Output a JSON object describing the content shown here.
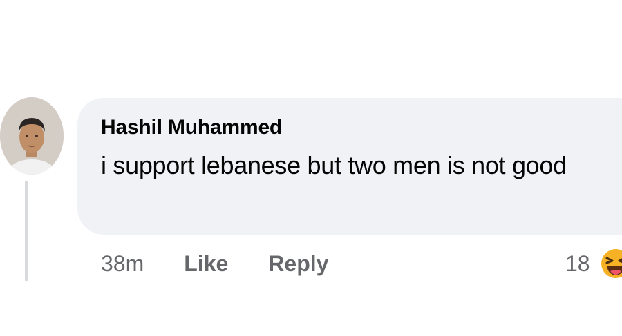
{
  "comment": {
    "author": "Hashil Muhammed",
    "text": "i support lebanese but two men is not good",
    "time": "38m",
    "like_label": "Like",
    "reply_label": "Reply",
    "reaction_count": "18",
    "reaction_icon": "haha-emoji-icon",
    "colors": {
      "bubble": "#f0f2f5",
      "secondary_text": "#65676b",
      "reaction_yellow": "#f7b125"
    }
  }
}
